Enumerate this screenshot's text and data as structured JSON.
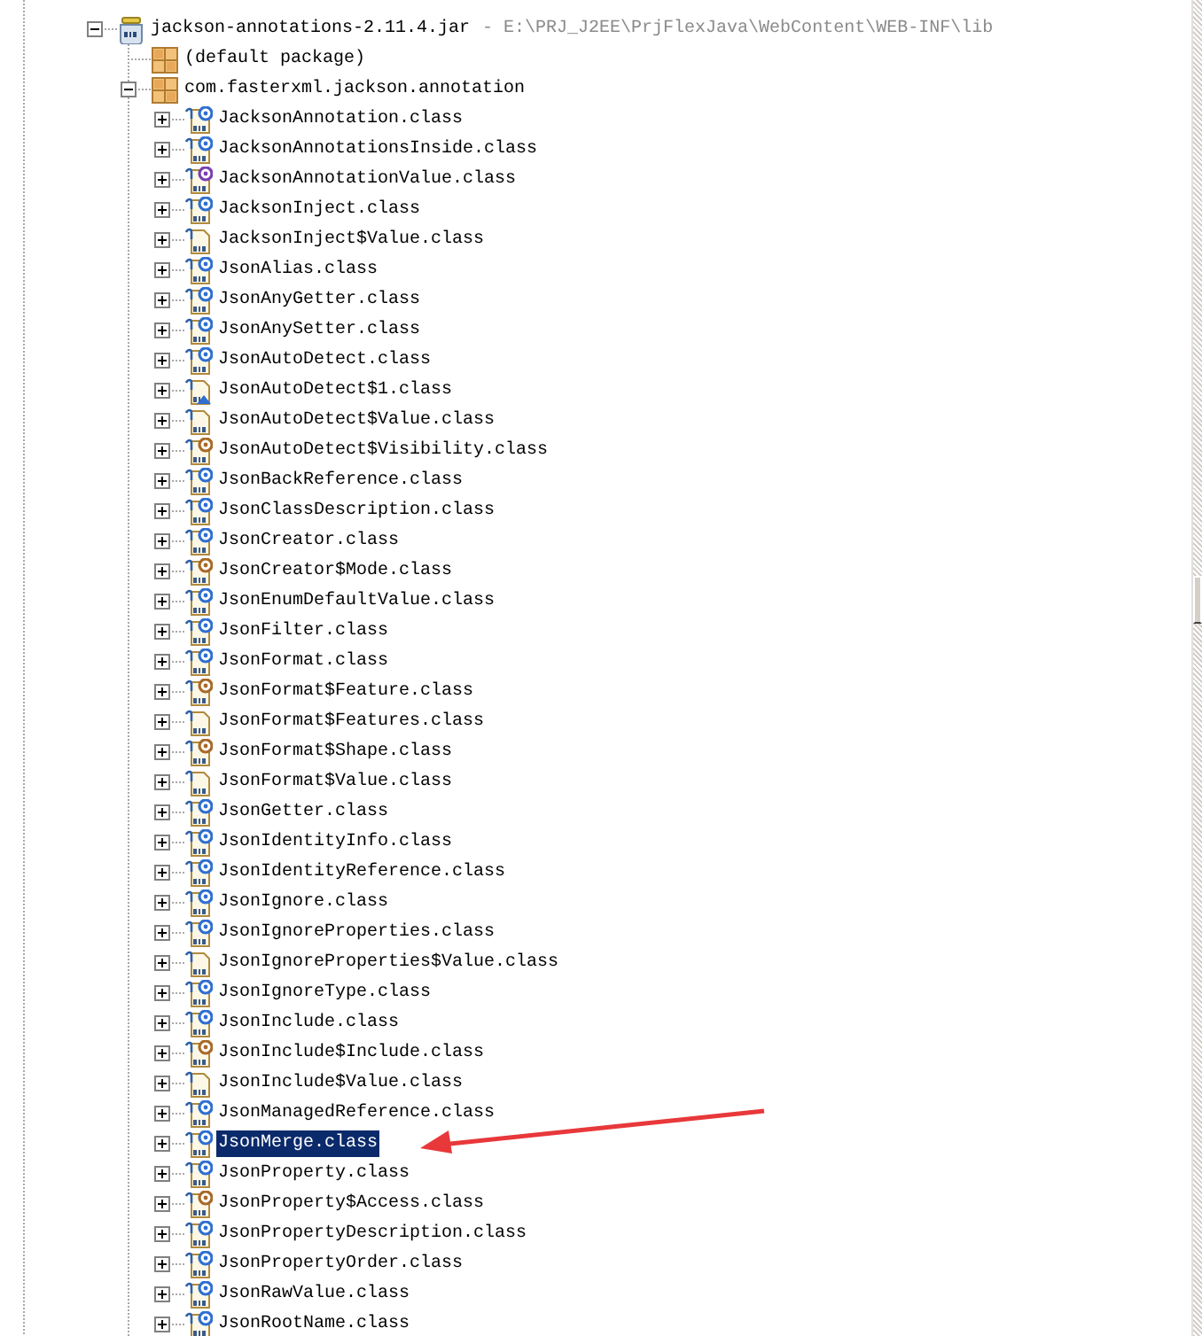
{
  "tree": [
    {
      "kind": "jar",
      "label": "jackson-annotations-2.11.4.jar",
      "location": " - E:\\PRJ_J2EE\\PrjFlexJava\\WebContent\\WEB-INF\\lib",
      "expanded": true,
      "selected": false,
      "children": [
        {
          "kind": "package",
          "label": "(default package)",
          "selected": false
        },
        {
          "kind": "package",
          "label": "com.fasterxml.jackson.annotation",
          "expanded": true,
          "selected": false,
          "children": [
            {
              "kind": "annotation",
              "label": "JacksonAnnotation.class",
              "expanded": false,
              "selected": false
            },
            {
              "kind": "annotation",
              "label": "JacksonAnnotationsInside.class",
              "expanded": false,
              "selected": false
            },
            {
              "kind": "interface",
              "label": "JacksonAnnotationValue.class",
              "expanded": false,
              "selected": false
            },
            {
              "kind": "annotation",
              "label": "JacksonInject.class",
              "expanded": false,
              "selected": false
            },
            {
              "kind": "class",
              "label": "JacksonInject$Value.class",
              "expanded": false,
              "selected": false
            },
            {
              "kind": "annotation",
              "label": "JsonAlias.class",
              "expanded": false,
              "selected": false
            },
            {
              "kind": "annotation",
              "label": "JsonAnyGetter.class",
              "expanded": false,
              "selected": false
            },
            {
              "kind": "annotation",
              "label": "JsonAnySetter.class",
              "expanded": false,
              "selected": false
            },
            {
              "kind": "annotation",
              "label": "JsonAutoDetect.class",
              "expanded": false,
              "selected": false
            },
            {
              "kind": "anonymous",
              "label": "JsonAutoDetect$1.class",
              "expanded": false,
              "selected": false
            },
            {
              "kind": "class",
              "label": "JsonAutoDetect$Value.class",
              "expanded": false,
              "selected": false
            },
            {
              "kind": "enum",
              "label": "JsonAutoDetect$Visibility.class",
              "expanded": false,
              "selected": false
            },
            {
              "kind": "annotation",
              "label": "JsonBackReference.class",
              "expanded": false,
              "selected": false
            },
            {
              "kind": "annotation",
              "label": "JsonClassDescription.class",
              "expanded": false,
              "selected": false
            },
            {
              "kind": "annotation",
              "label": "JsonCreator.class",
              "expanded": false,
              "selected": false
            },
            {
              "kind": "enum",
              "label": "JsonCreator$Mode.class",
              "expanded": false,
              "selected": false
            },
            {
              "kind": "annotation",
              "label": "JsonEnumDefaultValue.class",
              "expanded": false,
              "selected": false
            },
            {
              "kind": "annotation",
              "label": "JsonFilter.class",
              "expanded": false,
              "selected": false
            },
            {
              "kind": "annotation",
              "label": "JsonFormat.class",
              "expanded": false,
              "selected": false
            },
            {
              "kind": "enum",
              "label": "JsonFormat$Feature.class",
              "expanded": false,
              "selected": false
            },
            {
              "kind": "class",
              "label": "JsonFormat$Features.class",
              "expanded": false,
              "selected": false
            },
            {
              "kind": "enum",
              "label": "JsonFormat$Shape.class",
              "expanded": false,
              "selected": false
            },
            {
              "kind": "class",
              "label": "JsonFormat$Value.class",
              "expanded": false,
              "selected": false
            },
            {
              "kind": "annotation",
              "label": "JsonGetter.class",
              "expanded": false,
              "selected": false
            },
            {
              "kind": "annotation",
              "label": "JsonIdentityInfo.class",
              "expanded": false,
              "selected": false
            },
            {
              "kind": "annotation",
              "label": "JsonIdentityReference.class",
              "expanded": false,
              "selected": false
            },
            {
              "kind": "annotation",
              "label": "JsonIgnore.class",
              "expanded": false,
              "selected": false
            },
            {
              "kind": "annotation",
              "label": "JsonIgnoreProperties.class",
              "expanded": false,
              "selected": false
            },
            {
              "kind": "class",
              "label": "JsonIgnoreProperties$Value.class",
              "expanded": false,
              "selected": false
            },
            {
              "kind": "annotation",
              "label": "JsonIgnoreType.class",
              "expanded": false,
              "selected": false
            },
            {
              "kind": "annotation",
              "label": "JsonInclude.class",
              "expanded": false,
              "selected": false
            },
            {
              "kind": "enum",
              "label": "JsonInclude$Include.class",
              "expanded": false,
              "selected": false
            },
            {
              "kind": "class",
              "label": "JsonInclude$Value.class",
              "expanded": false,
              "selected": false
            },
            {
              "kind": "annotation",
              "label": "JsonManagedReference.class",
              "expanded": false,
              "selected": false
            },
            {
              "kind": "annotation",
              "label": "JsonMerge.class",
              "expanded": false,
              "selected": true,
              "arrow": true
            },
            {
              "kind": "annotation",
              "label": "JsonProperty.class",
              "expanded": false,
              "selected": false
            },
            {
              "kind": "enum",
              "label": "JsonProperty$Access.class",
              "expanded": false,
              "selected": false
            },
            {
              "kind": "annotation",
              "label": "JsonPropertyDescription.class",
              "expanded": false,
              "selected": false
            },
            {
              "kind": "annotation",
              "label": "JsonPropertyOrder.class",
              "expanded": false,
              "selected": false
            },
            {
              "kind": "annotation",
              "label": "JsonRawValue.class",
              "expanded": false,
              "selected": false
            },
            {
              "kind": "annotation",
              "label": "JsonRootName.class",
              "expanded": false,
              "selected": false
            }
          ]
        }
      ]
    }
  ]
}
